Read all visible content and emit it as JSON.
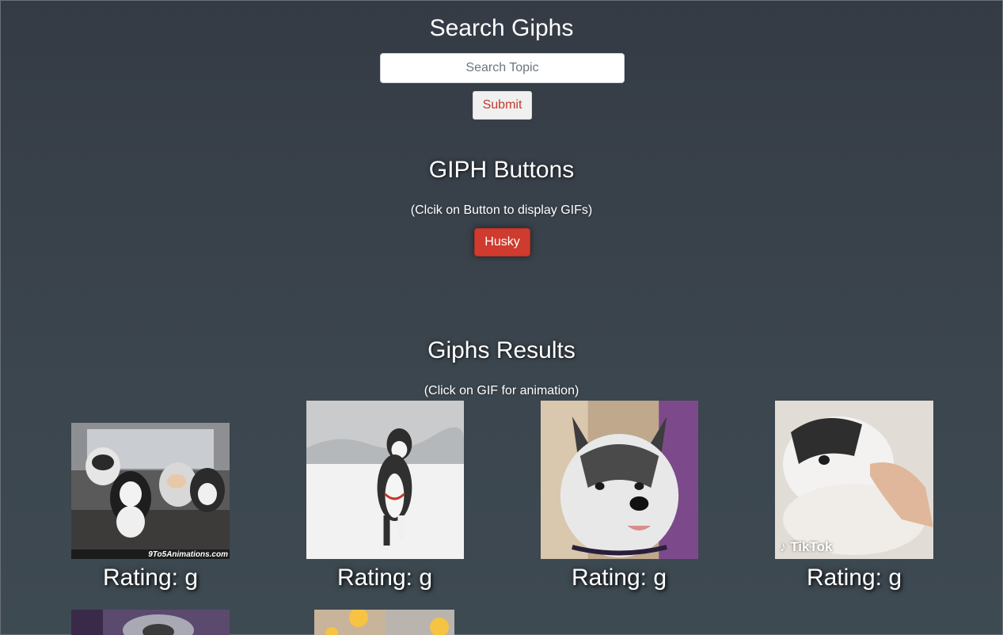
{
  "header": {
    "title": "Search Giphs",
    "search_placeholder": "Search Topic",
    "search_value": "",
    "submit_label": "Submit"
  },
  "buttons_section": {
    "title": "GIPH Buttons",
    "hint": "(Clcik on Button to display GIFs)",
    "topics": [
      "Husky"
    ]
  },
  "results_section": {
    "title": "Giphs Results",
    "hint": "(Click on GIF for animation)",
    "gifs": [
      {
        "rating": "Rating: g",
        "alt": "husky puppies",
        "watermark": "9To5Animations.com"
      },
      {
        "rating": "Rating: g",
        "alt": "husky running in snow",
        "watermark": ""
      },
      {
        "rating": "Rating: g",
        "alt": "husky face",
        "watermark": ""
      },
      {
        "rating": "Rating: g",
        "alt": "husky puppy lying down",
        "watermark": "TikTok"
      },
      {
        "rating": "",
        "alt": "husky partially visible",
        "watermark": ""
      },
      {
        "rating": "",
        "alt": "emoji gif partially visible",
        "watermark": ""
      }
    ]
  },
  "colors": {
    "background": "#3b454d",
    "accent": "#cf3b2e",
    "submit_text": "#c0392b"
  }
}
